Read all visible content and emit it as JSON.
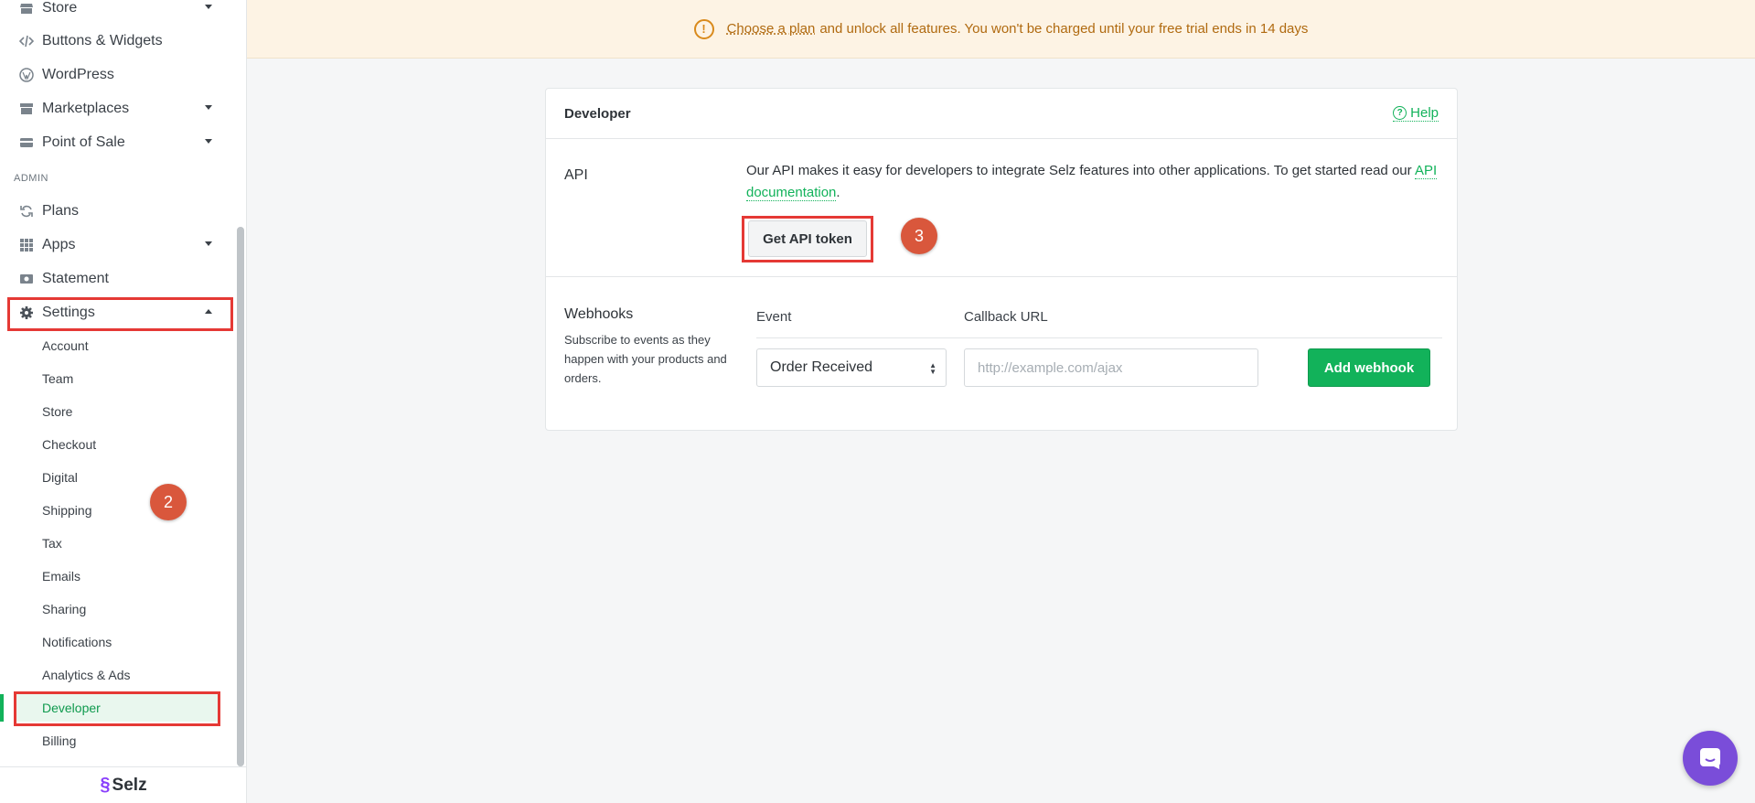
{
  "sidebar": {
    "nav_items": [
      {
        "label": "Store",
        "icon": "store-icon",
        "has_caret": true
      },
      {
        "label": "Buttons & Widgets",
        "icon": "code-icon",
        "has_caret": false
      },
      {
        "label": "WordPress",
        "icon": "wordpress-icon",
        "has_caret": false
      },
      {
        "label": "Marketplaces",
        "icon": "shop-icon",
        "has_caret": true
      },
      {
        "label": "Point of Sale",
        "icon": "card-icon",
        "has_caret": true
      }
    ],
    "admin_label": "ADMIN",
    "admin_items": [
      {
        "label": "Plans",
        "icon": "refresh-icon"
      },
      {
        "label": "Apps",
        "icon": "grid-icon"
      },
      {
        "label": "Statement",
        "icon": "money-icon"
      },
      {
        "label": "Settings",
        "icon": "gear-icon"
      }
    ],
    "settings_items": [
      "Account",
      "Team",
      "Store",
      "Checkout",
      "Digital",
      "Shipping",
      "Tax",
      "Emails",
      "Sharing",
      "Notifications",
      "Analytics & Ads",
      "Developer",
      "Billing"
    ],
    "brand": "Selz"
  },
  "steps": {
    "two": "2",
    "three": "3"
  },
  "banner": {
    "plan_link": "Choose a plan",
    "text": "and unlock all features. You won't be charged until your free trial ends in 14 days"
  },
  "card": {
    "title": "Developer",
    "help": "Help",
    "api_label": "API",
    "api_text": "Our API makes it easy for developers to integrate Selz features into other applications. To get started read our",
    "api_link": "API documentation",
    "api_end": ".",
    "token_button": "Get API token",
    "webhooks_label": "Webhooks",
    "webhooks_desc": "Subscribe to events as they happen with your products and orders.",
    "event_header": "Event",
    "callback_header": "Callback URL",
    "event_value": "Order Received",
    "callback_placeholder": "http://example.com/ajax",
    "add_button": "Add webhook"
  },
  "colors": {
    "accent": "#12b25a",
    "highlight": "#e53935",
    "step": "#d9573c",
    "chat": "#7a4dd9"
  }
}
